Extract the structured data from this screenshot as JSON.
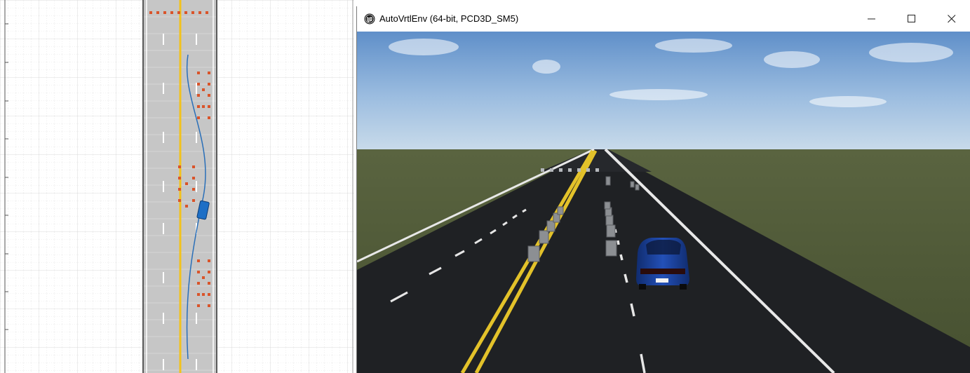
{
  "window": {
    "title": "AutoVrtlEnv (64-bit, PCD3D_SM5)",
    "icon": "unreal-engine-icon",
    "controls": [
      "minimize-icon",
      "maximize-icon",
      "close-icon"
    ]
  },
  "colors": {
    "road": "#c8c8c8",
    "center_line": "#f2c21c",
    "barrel": "#d9542a",
    "vehicle": "#1e6fc6",
    "path": "#2a6fb8",
    "sky": "#7fa9d8",
    "grass": "#4f5a33",
    "asphalt": "#1f2124"
  }
}
